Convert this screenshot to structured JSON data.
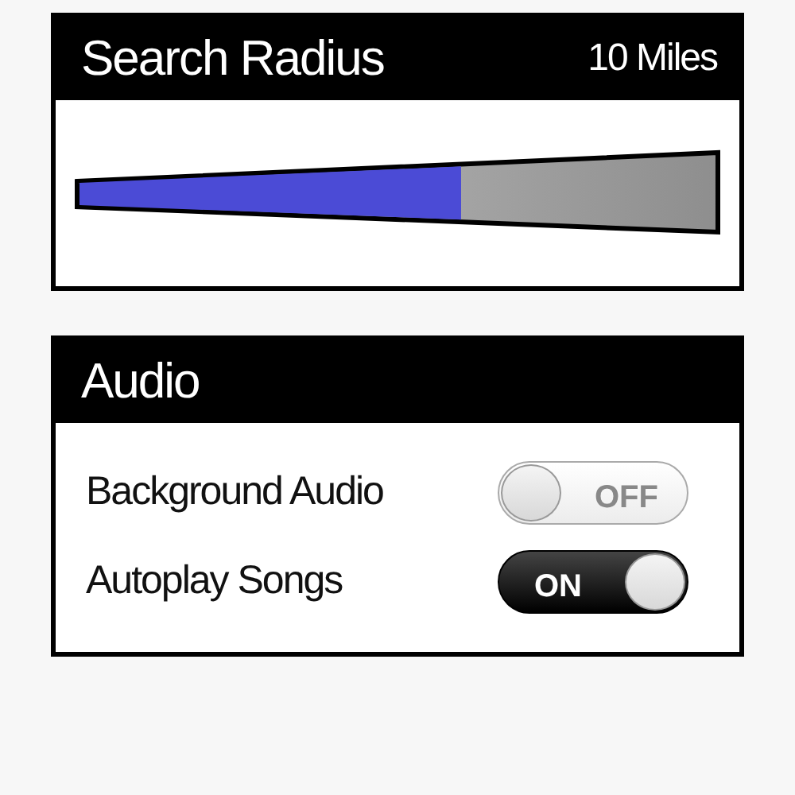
{
  "search_radius": {
    "title": "Search Radius",
    "reading": "10 Miles",
    "level": 0.6
  },
  "audio": {
    "title": "Audio",
    "settings": [
      {
        "label": "Background Audio",
        "on": false,
        "state_label": "OFF"
      },
      {
        "label": "Autoplay Songs",
        "on": true,
        "state_label": "ON"
      }
    ]
  }
}
